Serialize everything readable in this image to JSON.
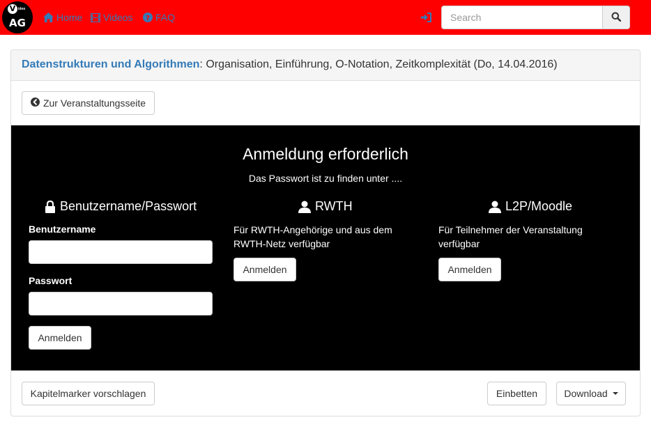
{
  "navbar": {
    "logo": {
      "letter": "V",
      "small_text": "ideo",
      "text": "AG"
    },
    "links": [
      {
        "label": "Home",
        "icon": "home-icon"
      },
      {
        "label": "Videos",
        "icon": "film-icon"
      },
      {
        "label": "FAQ",
        "icon": "question-circle-icon"
      }
    ],
    "login_icon": "log-in-icon",
    "search": {
      "placeholder": "Search",
      "value": "",
      "icon": "search-icon"
    }
  },
  "panel": {
    "heading": {
      "course": "Datenstrukturen und Algorithmen",
      "details": ": Organisation, Einführung, O-Notation, Zeitkomplexität (Do, 14.04.2016)"
    },
    "back_button": {
      "label": "Zur Veranstaltungsseite",
      "icon": "circle-arrow-left-icon"
    }
  },
  "login": {
    "title": "Anmeldung erforderlich",
    "hint": "Das Passwort ist zu finden unter ....",
    "columns": {
      "userpass": {
        "heading": "Benutzername/Passwort",
        "icon": "lock-icon",
        "username_label": "Benutzername",
        "username_value": "",
        "password_label": "Passwort",
        "password_value": "",
        "button": "Anmelden"
      },
      "rwth": {
        "heading": "RWTH",
        "icon": "user-icon",
        "text": "Für RWTH-Angehörige und aus dem RWTH-Netz verfügbar",
        "button": "Anmelden"
      },
      "l2p": {
        "heading": "L2P/Moodle",
        "icon": "user-icon",
        "text": "Für Teilnehmer der Veranstaltung verfügbar",
        "button": "Anmelden"
      }
    }
  },
  "footer": {
    "chapter_button": "Kapitelmarker vorschlagen",
    "embed_button": "Einbetten",
    "download_button": "Download"
  },
  "colors": {
    "navbar": "#ff0000",
    "link": "#337ab7",
    "login_area": "#000000",
    "panel_heading": "#f5f5f5",
    "border": "#dddddd"
  }
}
